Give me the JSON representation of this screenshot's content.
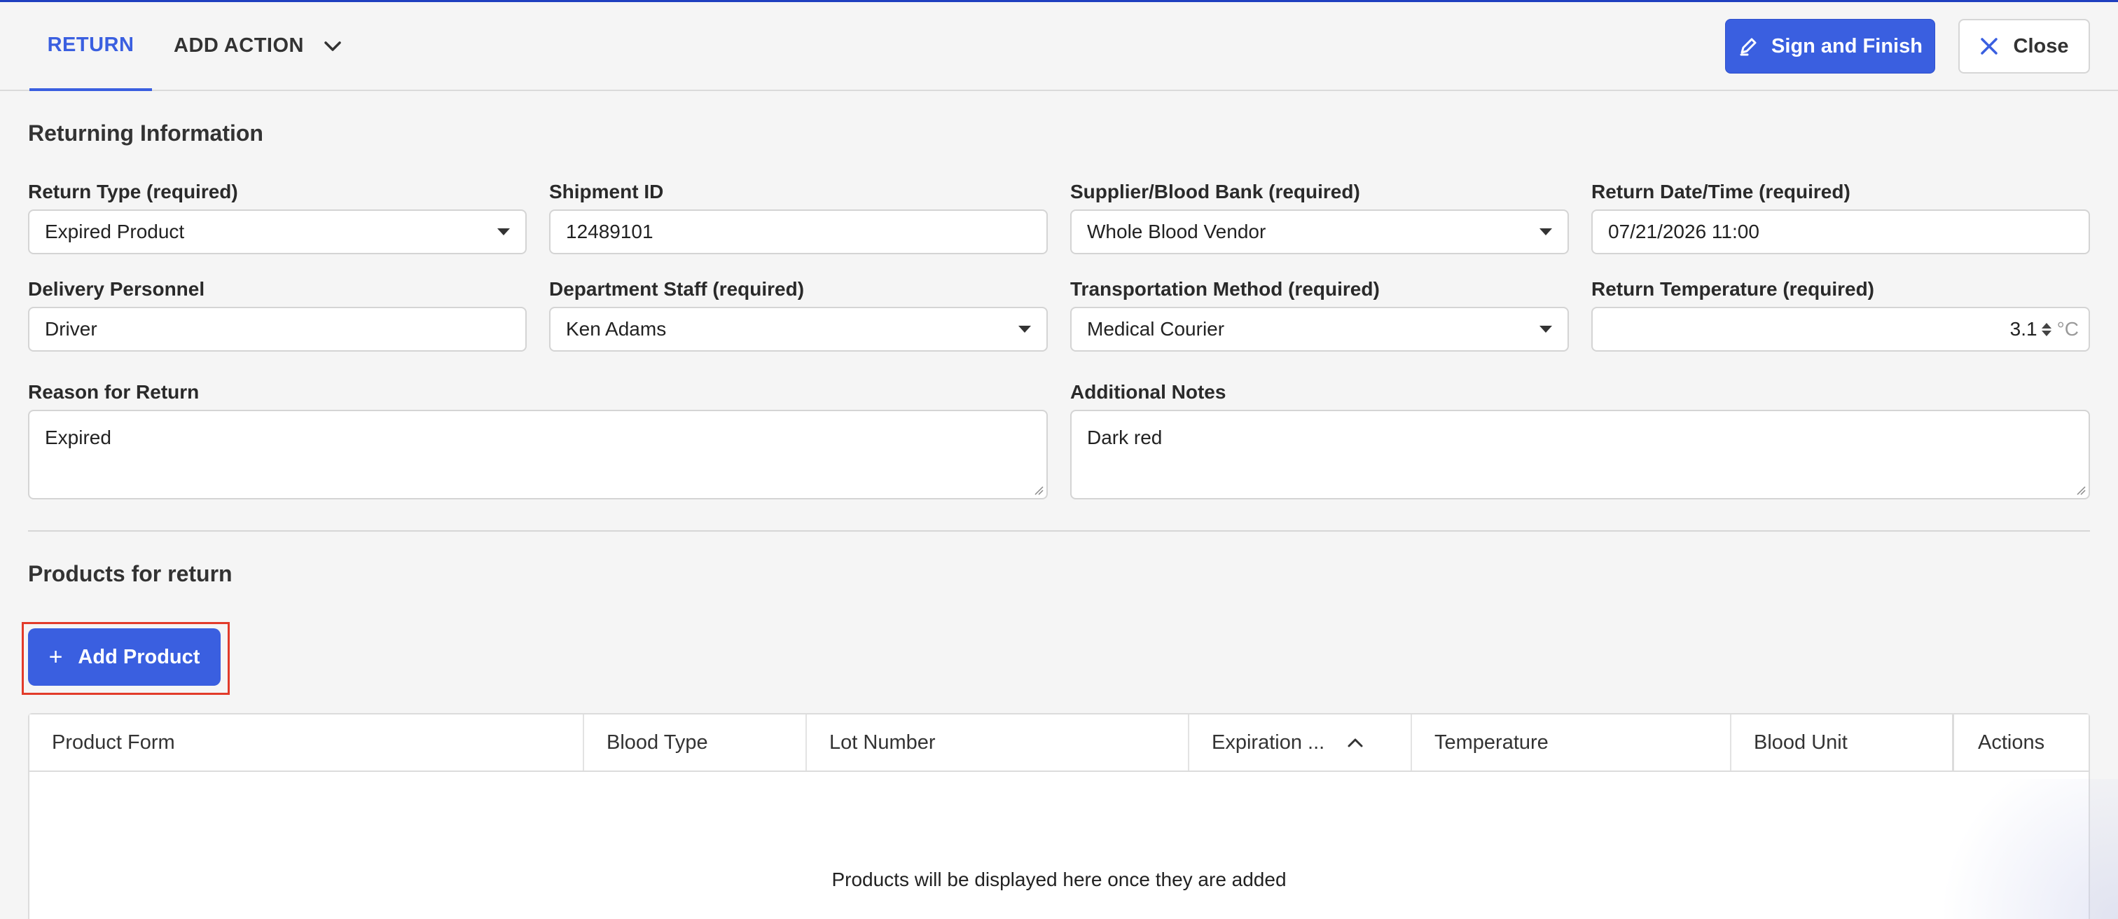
{
  "header": {
    "tabs": [
      {
        "label": "RETURN",
        "active": true
      },
      {
        "label": "ADD ACTION"
      }
    ],
    "sign_label": "Sign and Finish",
    "close_label": "Close",
    "accent": "#3a5fe0"
  },
  "returning": {
    "title": "Returning Information",
    "return_type": {
      "label": "Return Type (required)",
      "value": "Expired Product"
    },
    "shipment_id": {
      "label": "Shipment ID",
      "value": "12489101"
    },
    "supplier": {
      "label": "Supplier/Blood Bank (required)",
      "value": "Whole Blood Vendor"
    },
    "return_datetime": {
      "label": "Return Date/Time (required)",
      "value": "07/21/2026 11:00"
    },
    "delivery_personnel": {
      "label": "Delivery Personnel",
      "value": "Driver"
    },
    "department_staff": {
      "label": "Department Staff (required)",
      "value": "Ken Adams"
    },
    "transport_method": {
      "label": "Transportation Method (required)",
      "value": "Medical Courier"
    },
    "return_temperature": {
      "label": "Return Temperature (required)",
      "value": "3.1",
      "unit": "°C"
    },
    "reason": {
      "label": "Reason for Return",
      "value": "Expired"
    },
    "notes": {
      "label": "Additional Notes",
      "value": "Dark red"
    }
  },
  "products": {
    "title": "Products for return",
    "add_label": "Add Product",
    "columns": [
      "Product Form",
      "Blood Type",
      "Lot Number",
      "Expiration ...",
      "Temperature",
      "Blood Unit",
      "Actions"
    ],
    "empty_message": "Products will be displayed here once they are added"
  }
}
